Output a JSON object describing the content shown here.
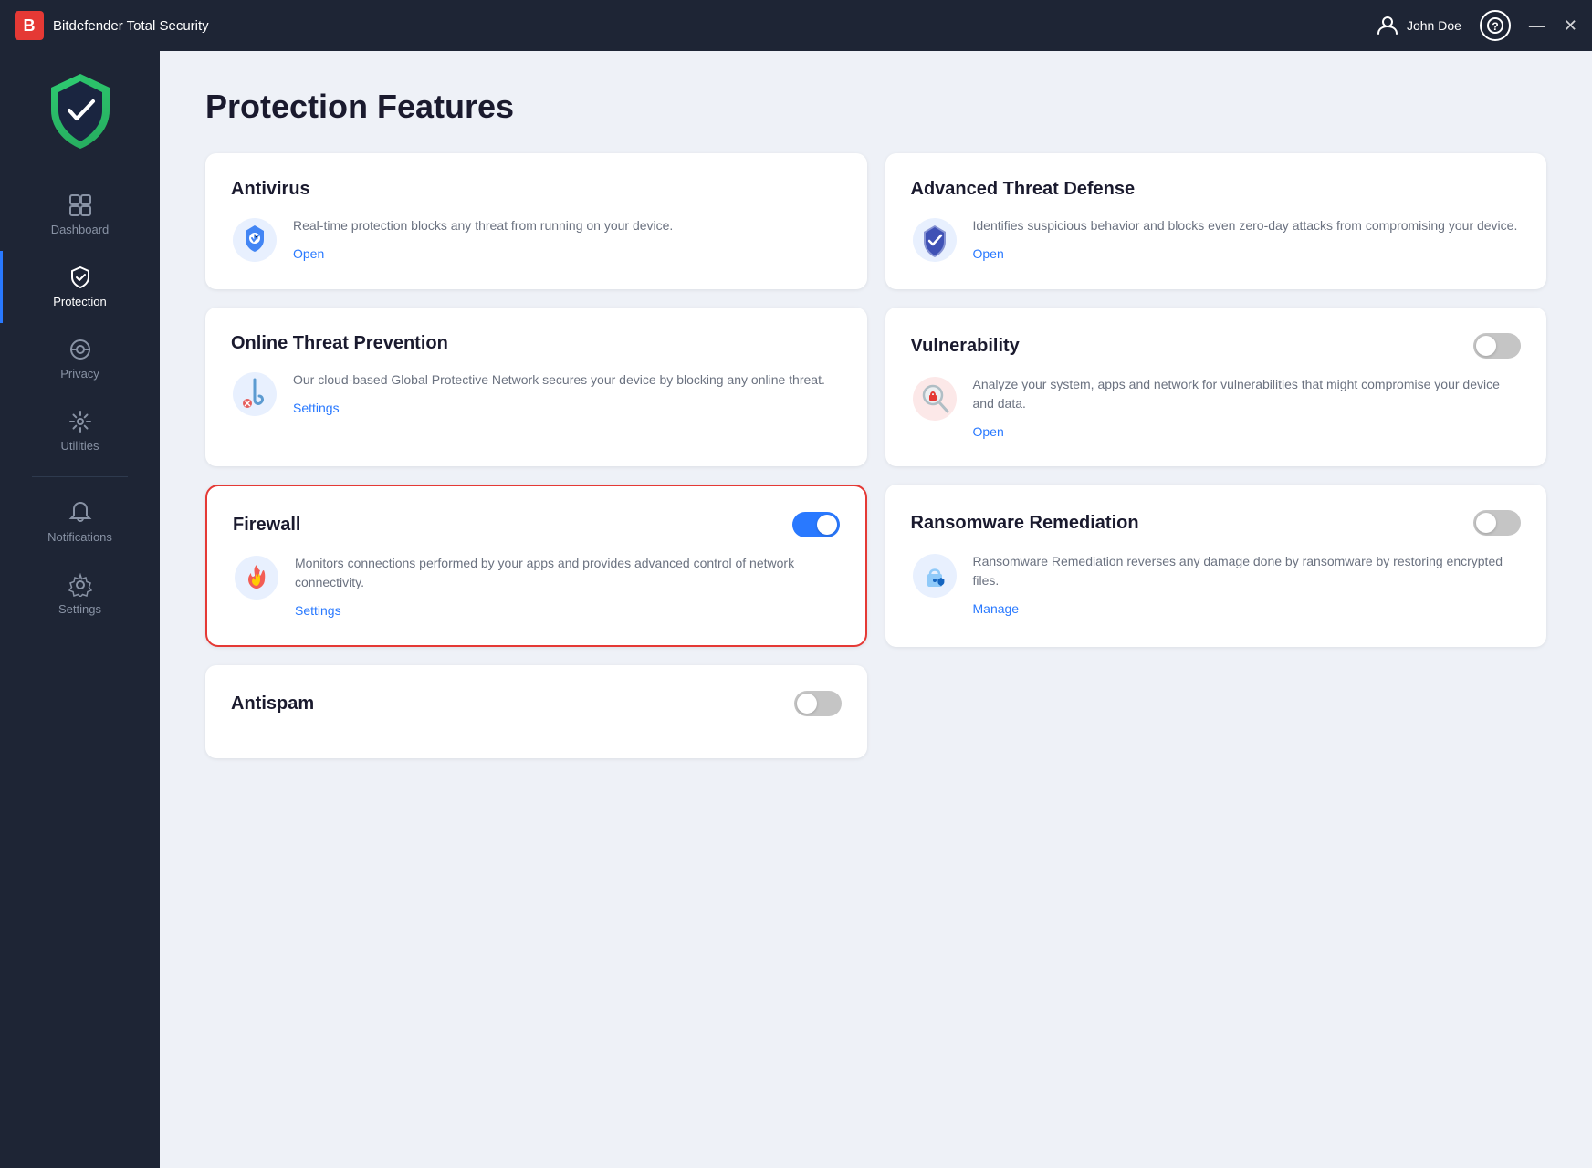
{
  "app": {
    "title": "Bitdefender Total Security",
    "logo_letter": "B",
    "user_name": "John Doe"
  },
  "titlebar": {
    "minimize": "—",
    "close": "✕"
  },
  "sidebar": {
    "items": [
      {
        "id": "dashboard",
        "label": "Dashboard",
        "active": false
      },
      {
        "id": "protection",
        "label": "Protection",
        "active": true
      },
      {
        "id": "privacy",
        "label": "Privacy",
        "active": false
      },
      {
        "id": "utilities",
        "label": "Utilities",
        "active": false
      },
      {
        "id": "notifications",
        "label": "Notifications",
        "active": false
      },
      {
        "id": "settings",
        "label": "Settings",
        "active": false
      }
    ]
  },
  "main": {
    "page_title": "Protection Features",
    "cards": [
      {
        "id": "antivirus",
        "title": "Antivirus",
        "description": "Real-time protection blocks any threat from running on your device.",
        "link_label": "Open",
        "has_toggle": false,
        "toggle_on": false,
        "highlighted": false
      },
      {
        "id": "advanced-threat",
        "title": "Advanced Threat Defense",
        "description": "Identifies suspicious behavior and blocks even zero-day attacks from compromising your device.",
        "link_label": "Open",
        "has_toggle": false,
        "toggle_on": false,
        "highlighted": false
      },
      {
        "id": "online-threat",
        "title": "Online Threat Prevention",
        "description": "Our cloud-based Global Protective Network secures your device by blocking any online threat.",
        "link_label": "Settings",
        "has_toggle": false,
        "toggle_on": false,
        "highlighted": false
      },
      {
        "id": "vulnerability",
        "title": "Vulnerability",
        "description": "Analyze your system, apps and network for vulnerabilities that might compromise your device and data.",
        "link_label": "Open",
        "has_toggle": true,
        "toggle_on": false,
        "highlighted": false
      },
      {
        "id": "firewall",
        "title": "Firewall",
        "description": "Monitors connections performed by your apps and provides advanced control of network connectivity.",
        "link_label": "Settings",
        "has_toggle": true,
        "toggle_on": true,
        "highlighted": true
      },
      {
        "id": "ransomware",
        "title": "Ransomware Remediation",
        "description": "Ransomware Remediation reverses any damage done by ransomware by restoring encrypted files.",
        "link_label": "Manage",
        "has_toggle": true,
        "toggle_on": false,
        "highlighted": false
      }
    ],
    "antispam": {
      "title": "Antispam",
      "has_toggle": true,
      "toggle_on": false
    }
  }
}
